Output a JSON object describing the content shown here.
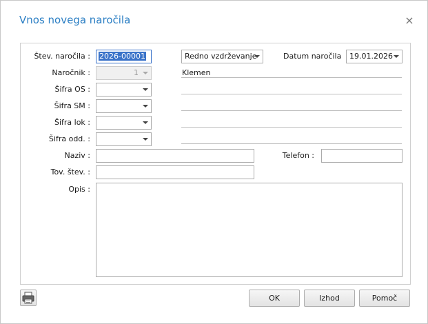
{
  "dialog": {
    "title": "Vnos novega naročila",
    "close_glyph": "×"
  },
  "form": {
    "order_number": {
      "label": "Štev. naročila :",
      "value": "2026-00001"
    },
    "order_type": {
      "value": "Redno vzdrževanje"
    },
    "order_date": {
      "label": "Datum naročila",
      "value": "19.01.2026"
    },
    "client": {
      "label": "Naročnik :",
      "value": "1",
      "name": "Klemen"
    },
    "sifra_os": {
      "label": "Šifra OS :",
      "value": "",
      "description": ""
    },
    "sifra_sm": {
      "label": "Šifra SM :",
      "value": "",
      "description": ""
    },
    "sifra_lok": {
      "label": "Šifra lok :",
      "value": "",
      "description": ""
    },
    "sifra_odd": {
      "label": "Šifra odd. :",
      "value": "",
      "description": ""
    },
    "naziv": {
      "label": "Naziv :",
      "value": ""
    },
    "telefon": {
      "label": "Telefon :",
      "value": ""
    },
    "tov_stev": {
      "label": "Tov. štev. :",
      "value": ""
    },
    "opis": {
      "label": "Opis :",
      "value": ""
    }
  },
  "buttons": {
    "ok": "OK",
    "exit": "Izhod",
    "help": "Pomoč",
    "print_icon": "printer-icon"
  },
  "colors": {
    "title": "#2c7fc4",
    "selection": "#3a73c9"
  }
}
